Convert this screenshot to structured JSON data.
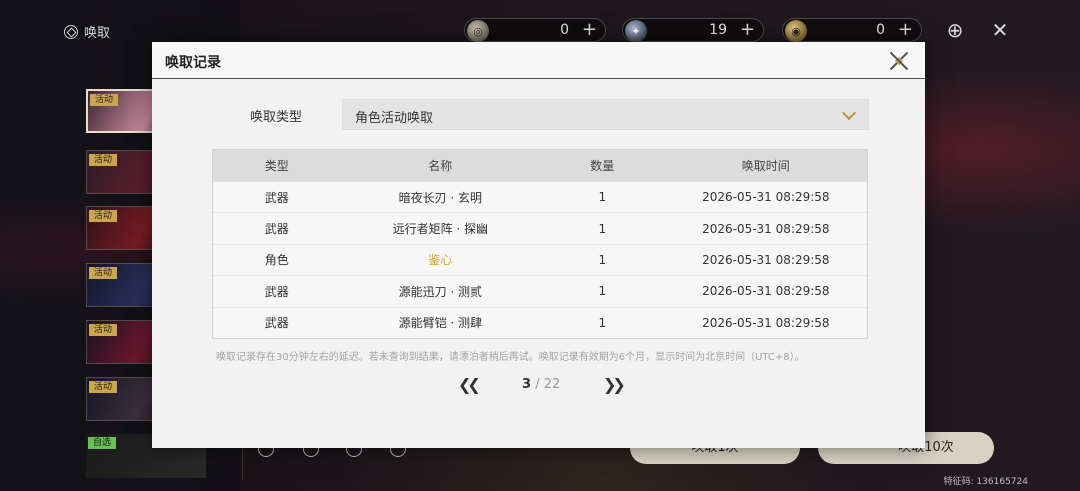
{
  "page_title": "唤取",
  "currencies": [
    {
      "icon": "lustrous-tide-icon",
      "value": "0"
    },
    {
      "icon": "astrite-icon",
      "value": "19"
    },
    {
      "icon": "radiant-tide-icon",
      "value": "0"
    }
  ],
  "plus_label": "+",
  "banners": [
    {
      "tag": "活动"
    },
    {
      "tag": "活动"
    },
    {
      "tag": "活动"
    },
    {
      "tag": "活动"
    },
    {
      "tag": "活动"
    },
    {
      "tag": "活动"
    },
    {
      "tag": "自选"
    }
  ],
  "bottom": {
    "pull10_label": "唤取10次",
    "pull1_label": "唤取1次"
  },
  "footer_id": "特征码: 136165724",
  "modal": {
    "title": "唤取记录",
    "type_label": "唤取类型",
    "type_value": "角色活动唤取",
    "columns": [
      "类型",
      "名称",
      "数量",
      "唤取时间"
    ],
    "rows": [
      {
        "type": "武器",
        "name": "暗夜长刃 · 玄明",
        "qty": "1",
        "time": "2026-05-31 08:29:58"
      },
      {
        "type": "武器",
        "name": "远行者矩阵 · 探幽",
        "qty": "1",
        "time": "2026-05-31 08:29:58"
      },
      {
        "type": "角色",
        "name": "鉴心",
        "qty": "1",
        "time": "2026-05-31 08:29:58"
      },
      {
        "type": "武器",
        "name": "源能迅刀 · 测贰",
        "qty": "1",
        "time": "2026-05-31 08:29:58"
      },
      {
        "type": "武器",
        "name": "源能臂铠 · 测肆",
        "qty": "1",
        "time": "2026-05-31 08:29:58"
      }
    ],
    "note": "唤取记录存在30分钟左右的延迟。若未查询到结果，请漂泊者稍后再试。唤取记录有效期为6个月，显示时间为北京时间（UTC+8）。",
    "page_current": "3",
    "page_total": "/ 22",
    "highlight_color": "#d4a52a"
  }
}
